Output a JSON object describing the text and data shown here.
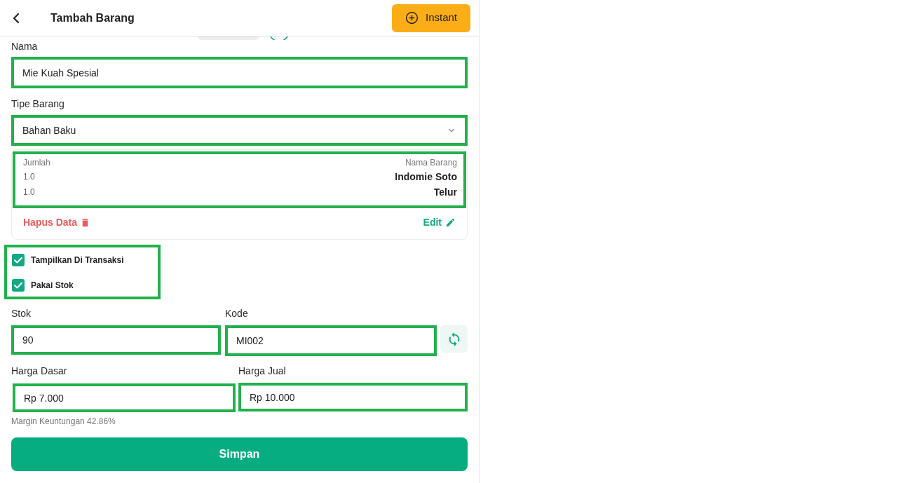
{
  "header": {
    "title": "Tambah Barang",
    "instant_button": "Instant"
  },
  "form": {
    "nama": {
      "label": "Nama",
      "value": "Mie Kuah Spesial",
      "highlighted": true
    },
    "tipe_barang": {
      "label": "Tipe Barang",
      "value": "Bahan Baku",
      "highlighted": true
    },
    "ingredients": {
      "highlighted": true,
      "columns": [
        "Jumlah",
        "Nama Barang"
      ],
      "rows": [
        {
          "jumlah": "1.0",
          "nama_barang": "Indomie Soto"
        },
        {
          "jumlah": "1.0",
          "nama_barang": "Telur"
        }
      ],
      "delete_label": "Hapus Data",
      "edit_label": "Edit"
    },
    "options": {
      "highlighted": true,
      "items": [
        {
          "label": "Tampilkan Di Transaksi",
          "checked": true
        },
        {
          "label": "Pakai Stok",
          "checked": true
        }
      ]
    },
    "stok": {
      "label": "Stok",
      "value": "90",
      "highlighted": true
    },
    "kode": {
      "label": "Kode",
      "value": "MI002",
      "highlighted": true
    },
    "harga_dasar": {
      "label": "Harga Dasar",
      "value": "Rp 7.000",
      "highlighted": true
    },
    "harga_jual": {
      "label": "Harga Jual",
      "value": "Rp 10.000",
      "highlighted": true
    },
    "margin_note": "Margin Keuntungan 42.86%"
  },
  "save_button": "Simpan"
}
